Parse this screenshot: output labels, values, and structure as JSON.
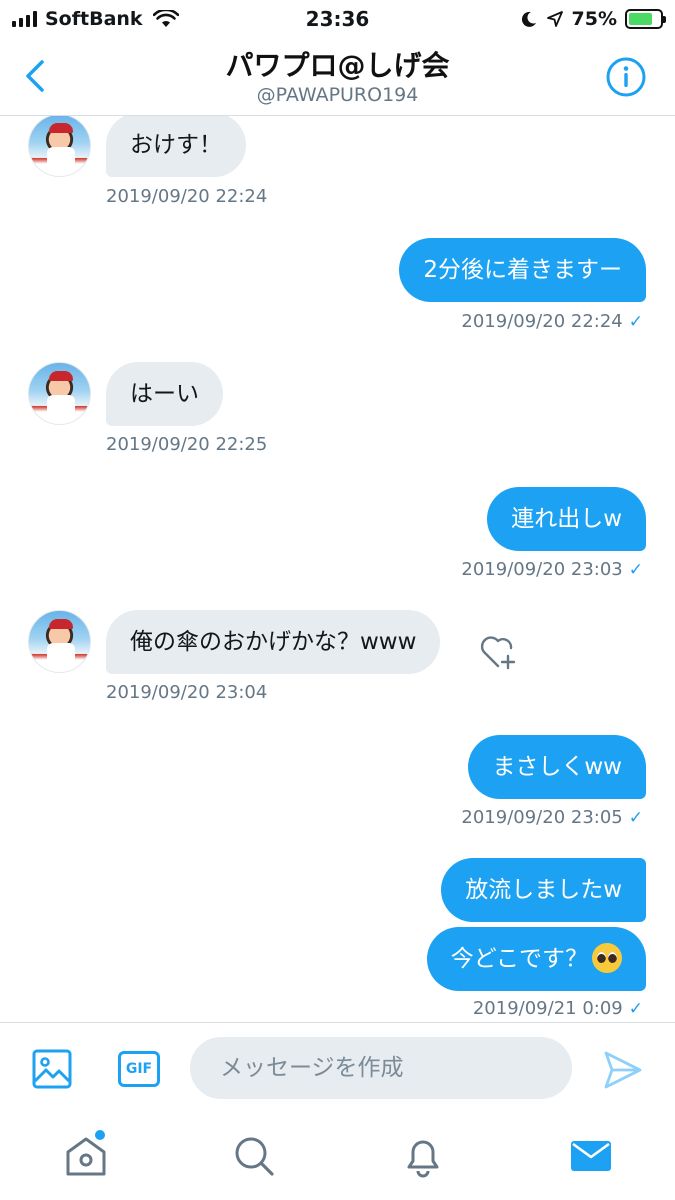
{
  "status_bar": {
    "carrier": "SoftBank",
    "time": "23:36",
    "battery_percent": "75%",
    "battery_level": 0.75
  },
  "header": {
    "title": "パワプロ@しげ会",
    "handle": "@PAWAPURO194"
  },
  "messages": [
    {
      "direction": "in",
      "text": "おけす！",
      "timestamp": "2019/09/20 22:24"
    },
    {
      "direction": "out",
      "text": "2分後に着きますー",
      "timestamp": "2019/09/20 22:24"
    },
    {
      "direction": "in",
      "text": "はーい",
      "timestamp": "2019/09/20 22:25"
    },
    {
      "direction": "out",
      "text": "連れ出しw",
      "timestamp": "2019/09/20 23:03"
    },
    {
      "direction": "in",
      "text": "俺の傘のおかげかな？www",
      "timestamp": "2019/09/20 23:04"
    },
    {
      "direction": "out",
      "text": "まさしくww",
      "timestamp": "2019/09/20 23:05"
    },
    {
      "direction": "out",
      "text": "放流しましたw",
      "timestamp": ""
    },
    {
      "direction": "out",
      "text": "今どこです？",
      "timestamp": "2019/09/21 0:09",
      "emoji": "pleading-face"
    }
  ],
  "composer": {
    "gif_label": "GIF",
    "placeholder": "メッセージを作成"
  },
  "tabs": [
    {
      "name": "home",
      "icon": "home-icon",
      "has_badge": true
    },
    {
      "name": "search",
      "icon": "search-icon"
    },
    {
      "name": "notifications",
      "icon": "bell-icon"
    },
    {
      "name": "messages",
      "icon": "mail-icon",
      "active": true
    }
  ],
  "colors": {
    "accent": "#1da1f2",
    "incoming_bubble": "#e6ecf0",
    "timestamp": "#657786"
  }
}
